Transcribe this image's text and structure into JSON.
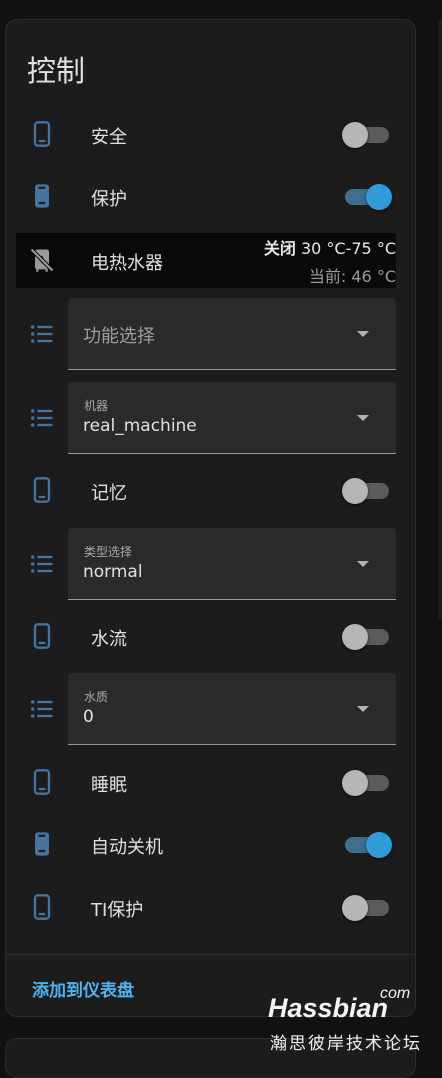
{
  "card": {
    "title": "控制",
    "footer_link": "添加到仪表盘"
  },
  "entities": {
    "safety": {
      "label": "安全",
      "state": "off"
    },
    "protect": {
      "label": "保护",
      "state": "on"
    },
    "heater": {
      "label": "电热水器",
      "mode": "关闭",
      "range": "30 °C-75 °C",
      "current": "当前: 46 °C"
    },
    "function_select": {
      "placeholder": "功能选择"
    },
    "machine": {
      "label": "机器",
      "value": "real_machine"
    },
    "memory": {
      "label": "记忆",
      "state": "off"
    },
    "type_select": {
      "label": "类型选择",
      "value": "normal"
    },
    "water_flow": {
      "label": "水流",
      "state": "off"
    },
    "water_quality": {
      "label": "水质",
      "value": "0"
    },
    "sleep": {
      "label": "睡眠",
      "state": "off"
    },
    "auto_off": {
      "label": "自动关机",
      "state": "on"
    },
    "ti_protect": {
      "label": "TI保护",
      "state": "off"
    }
  },
  "watermark": {
    "brand": "Hassbian",
    "suffix": "com",
    "tagline": "瀚思彼岸技术论坛"
  },
  "colors": {
    "icon": "#44739e",
    "accent": "#2f9cd8",
    "link": "#4fb3ef",
    "card_bg": "#1c1c1c"
  }
}
